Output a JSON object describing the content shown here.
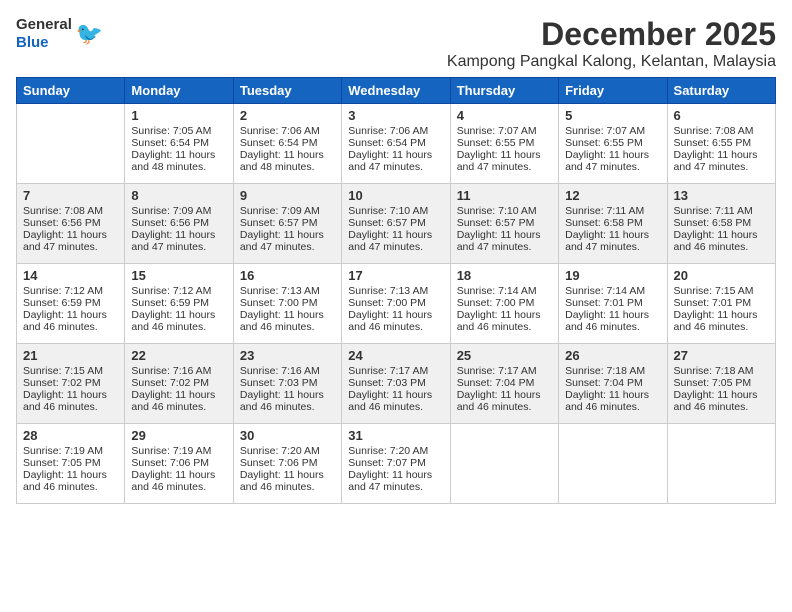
{
  "logo": {
    "general": "General",
    "blue": "Blue"
  },
  "title": "December 2025",
  "location": "Kampong Pangkal Kalong, Kelantan, Malaysia",
  "headers": [
    "Sunday",
    "Monday",
    "Tuesday",
    "Wednesday",
    "Thursday",
    "Friday",
    "Saturday"
  ],
  "weeks": [
    [
      {
        "day": "",
        "sunrise": "",
        "sunset": "",
        "daylight": ""
      },
      {
        "day": "1",
        "sunrise": "Sunrise: 7:05 AM",
        "sunset": "Sunset: 6:54 PM",
        "daylight": "Daylight: 11 hours and 48 minutes."
      },
      {
        "day": "2",
        "sunrise": "Sunrise: 7:06 AM",
        "sunset": "Sunset: 6:54 PM",
        "daylight": "Daylight: 11 hours and 48 minutes."
      },
      {
        "day": "3",
        "sunrise": "Sunrise: 7:06 AM",
        "sunset": "Sunset: 6:54 PM",
        "daylight": "Daylight: 11 hours and 47 minutes."
      },
      {
        "day": "4",
        "sunrise": "Sunrise: 7:07 AM",
        "sunset": "Sunset: 6:55 PM",
        "daylight": "Daylight: 11 hours and 47 minutes."
      },
      {
        "day": "5",
        "sunrise": "Sunrise: 7:07 AM",
        "sunset": "Sunset: 6:55 PM",
        "daylight": "Daylight: 11 hours and 47 minutes."
      },
      {
        "day": "6",
        "sunrise": "Sunrise: 7:08 AM",
        "sunset": "Sunset: 6:55 PM",
        "daylight": "Daylight: 11 hours and 47 minutes."
      }
    ],
    [
      {
        "day": "7",
        "sunrise": "Sunrise: 7:08 AM",
        "sunset": "Sunset: 6:56 PM",
        "daylight": "Daylight: 11 hours and 47 minutes."
      },
      {
        "day": "8",
        "sunrise": "Sunrise: 7:09 AM",
        "sunset": "Sunset: 6:56 PM",
        "daylight": "Daylight: 11 hours and 47 minutes."
      },
      {
        "day": "9",
        "sunrise": "Sunrise: 7:09 AM",
        "sunset": "Sunset: 6:57 PM",
        "daylight": "Daylight: 11 hours and 47 minutes."
      },
      {
        "day": "10",
        "sunrise": "Sunrise: 7:10 AM",
        "sunset": "Sunset: 6:57 PM",
        "daylight": "Daylight: 11 hours and 47 minutes."
      },
      {
        "day": "11",
        "sunrise": "Sunrise: 7:10 AM",
        "sunset": "Sunset: 6:57 PM",
        "daylight": "Daylight: 11 hours and 47 minutes."
      },
      {
        "day": "12",
        "sunrise": "Sunrise: 7:11 AM",
        "sunset": "Sunset: 6:58 PM",
        "daylight": "Daylight: 11 hours and 47 minutes."
      },
      {
        "day": "13",
        "sunrise": "Sunrise: 7:11 AM",
        "sunset": "Sunset: 6:58 PM",
        "daylight": "Daylight: 11 hours and 46 minutes."
      }
    ],
    [
      {
        "day": "14",
        "sunrise": "Sunrise: 7:12 AM",
        "sunset": "Sunset: 6:59 PM",
        "daylight": "Daylight: 11 hours and 46 minutes."
      },
      {
        "day": "15",
        "sunrise": "Sunrise: 7:12 AM",
        "sunset": "Sunset: 6:59 PM",
        "daylight": "Daylight: 11 hours and 46 minutes."
      },
      {
        "day": "16",
        "sunrise": "Sunrise: 7:13 AM",
        "sunset": "Sunset: 7:00 PM",
        "daylight": "Daylight: 11 hours and 46 minutes."
      },
      {
        "day": "17",
        "sunrise": "Sunrise: 7:13 AM",
        "sunset": "Sunset: 7:00 PM",
        "daylight": "Daylight: 11 hours and 46 minutes."
      },
      {
        "day": "18",
        "sunrise": "Sunrise: 7:14 AM",
        "sunset": "Sunset: 7:00 PM",
        "daylight": "Daylight: 11 hours and 46 minutes."
      },
      {
        "day": "19",
        "sunrise": "Sunrise: 7:14 AM",
        "sunset": "Sunset: 7:01 PM",
        "daylight": "Daylight: 11 hours and 46 minutes."
      },
      {
        "day": "20",
        "sunrise": "Sunrise: 7:15 AM",
        "sunset": "Sunset: 7:01 PM",
        "daylight": "Daylight: 11 hours and 46 minutes."
      }
    ],
    [
      {
        "day": "21",
        "sunrise": "Sunrise: 7:15 AM",
        "sunset": "Sunset: 7:02 PM",
        "daylight": "Daylight: 11 hours and 46 minutes."
      },
      {
        "day": "22",
        "sunrise": "Sunrise: 7:16 AM",
        "sunset": "Sunset: 7:02 PM",
        "daylight": "Daylight: 11 hours and 46 minutes."
      },
      {
        "day": "23",
        "sunrise": "Sunrise: 7:16 AM",
        "sunset": "Sunset: 7:03 PM",
        "daylight": "Daylight: 11 hours and 46 minutes."
      },
      {
        "day": "24",
        "sunrise": "Sunrise: 7:17 AM",
        "sunset": "Sunset: 7:03 PM",
        "daylight": "Daylight: 11 hours and 46 minutes."
      },
      {
        "day": "25",
        "sunrise": "Sunrise: 7:17 AM",
        "sunset": "Sunset: 7:04 PM",
        "daylight": "Daylight: 11 hours and 46 minutes."
      },
      {
        "day": "26",
        "sunrise": "Sunrise: 7:18 AM",
        "sunset": "Sunset: 7:04 PM",
        "daylight": "Daylight: 11 hours and 46 minutes."
      },
      {
        "day": "27",
        "sunrise": "Sunrise: 7:18 AM",
        "sunset": "Sunset: 7:05 PM",
        "daylight": "Daylight: 11 hours and 46 minutes."
      }
    ],
    [
      {
        "day": "28",
        "sunrise": "Sunrise: 7:19 AM",
        "sunset": "Sunset: 7:05 PM",
        "daylight": "Daylight: 11 hours and 46 minutes."
      },
      {
        "day": "29",
        "sunrise": "Sunrise: 7:19 AM",
        "sunset": "Sunset: 7:06 PM",
        "daylight": "Daylight: 11 hours and 46 minutes."
      },
      {
        "day": "30",
        "sunrise": "Sunrise: 7:20 AM",
        "sunset": "Sunset: 7:06 PM",
        "daylight": "Daylight: 11 hours and 46 minutes."
      },
      {
        "day": "31",
        "sunrise": "Sunrise: 7:20 AM",
        "sunset": "Sunset: 7:07 PM",
        "daylight": "Daylight: 11 hours and 47 minutes."
      },
      {
        "day": "",
        "sunrise": "",
        "sunset": "",
        "daylight": ""
      },
      {
        "day": "",
        "sunrise": "",
        "sunset": "",
        "daylight": ""
      },
      {
        "day": "",
        "sunrise": "",
        "sunset": "",
        "daylight": ""
      }
    ]
  ]
}
